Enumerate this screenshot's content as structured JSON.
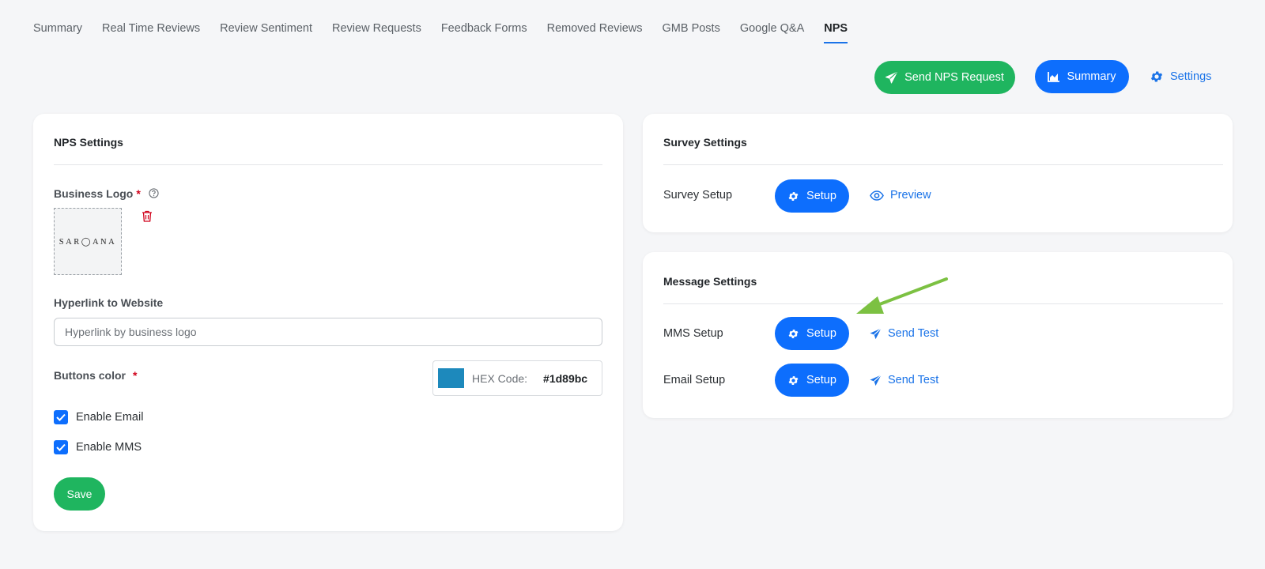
{
  "tabs": [
    {
      "label": "Summary",
      "active": false
    },
    {
      "label": "Real Time Reviews",
      "active": false
    },
    {
      "label": "Review Sentiment",
      "active": false
    },
    {
      "label": "Review Requests",
      "active": false
    },
    {
      "label": "Feedback Forms",
      "active": false
    },
    {
      "label": "Removed Reviews",
      "active": false
    },
    {
      "label": "GMB Posts",
      "active": false
    },
    {
      "label": "Google Q&A",
      "active": false
    },
    {
      "label": "NPS",
      "active": true
    }
  ],
  "toolbar": {
    "send_nps_label": "Send NPS Request",
    "summary_label": "Summary",
    "settings_label": "Settings"
  },
  "nps_settings": {
    "title": "NPS Settings",
    "business_logo_label": "Business Logo",
    "required_mark": "*",
    "logo_text": "SAR◯ANA",
    "hyperlink_label": "Hyperlink to Website",
    "hyperlink_placeholder": "Hyperlink by business logo",
    "hyperlink_value": "",
    "buttons_color_label": "Buttons color",
    "hex_code_label": "HEX Code:",
    "hex_value": "#1d89bc",
    "swatch_color": "#1d89bc",
    "enable_email_label": "Enable Email",
    "enable_email_checked": true,
    "enable_mms_label": "Enable MMS",
    "enable_mms_checked": true,
    "save_label": "Save"
  },
  "survey_settings": {
    "title": "Survey Settings",
    "survey_setup_label": "Survey Setup",
    "setup_label": "Setup",
    "preview_label": "Preview"
  },
  "message_settings": {
    "title": "Message Settings",
    "mms_setup_label": "MMS Setup",
    "email_setup_label": "Email Setup",
    "setup_label": "Setup",
    "send_test_label": "Send Test"
  },
  "colors": {
    "green": "#1fb55f",
    "blue": "#0d6efd",
    "link_blue": "#1a73e8",
    "required_red": "#d0021b",
    "annotation_arrow": "#7cc142"
  }
}
